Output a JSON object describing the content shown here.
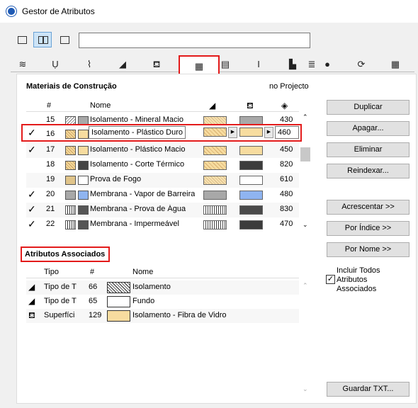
{
  "window": {
    "title": "Gestor de Atributos"
  },
  "colors": {
    "highlight_border": "#e31b1b",
    "active_view": "#cde4f7",
    "beige": "#f7dc9f",
    "blue": "#8fb4f0",
    "dark": "#444444"
  },
  "view_buttons": [
    {
      "icon": "list-view-icon"
    },
    {
      "icon": "dual-list-view-icon"
    },
    {
      "icon": "single-view-icon"
    }
  ],
  "search": {
    "value": "",
    "placeholder": ""
  },
  "tabs": [
    {
      "icon": "layers-icon",
      "glyph": "≋"
    },
    {
      "icon": "pen-icon",
      "glyph": "Ụ"
    },
    {
      "icon": "line-type-icon",
      "glyph": "⌇"
    },
    {
      "icon": "fill-icon",
      "glyph": "◢"
    },
    {
      "icon": "surface-icon",
      "glyph": "⛾"
    },
    {
      "icon": "building-material-icon",
      "glyph": "▦"
    },
    {
      "icon": "composite-icon",
      "glyph": "▤"
    },
    {
      "icon": "profile-icon",
      "glyph": "I"
    },
    {
      "icon": "zone-category-icon",
      "glyph": "▙"
    },
    {
      "icon": "mep-icon",
      "glyph": "≣"
    },
    {
      "icon": "globe-icon",
      "glyph": "●"
    },
    {
      "icon": "operation-profile-icon",
      "glyph": "⟳"
    },
    {
      "icon": "grid-icon",
      "glyph": "▦"
    }
  ],
  "materials": {
    "title": "Materiais de Construção",
    "scope": "no Projecto",
    "columns": {
      "num": "#",
      "name": "Nome"
    },
    "rows": [
      {
        "check": "",
        "num": "15",
        "name": "Isolamento - Mineral Macio",
        "value": "430"
      },
      {
        "check": "✓",
        "num": "16",
        "name": "Isolamento - Plástico Duro",
        "value": "460"
      },
      {
        "check": "✓",
        "num": "17",
        "name": "Isolamento - Plástico Macio",
        "value": "450"
      },
      {
        "check": "",
        "num": "18",
        "name": "Isolamento - Corte Térmico",
        "value": "820"
      },
      {
        "check": "",
        "num": "19",
        "name": "Prova de Fogo",
        "value": "610"
      },
      {
        "check": "✓",
        "num": "20",
        "name": "Membrana - Vapor de Barreira",
        "value": "480"
      },
      {
        "check": "✓",
        "num": "21",
        "name": "Membrana - Prova de Água",
        "value": "830"
      },
      {
        "check": "✓",
        "num": "22",
        "name": "Membrana - Impermeável",
        "value": "470"
      }
    ]
  },
  "buttons": {
    "duplicar": "Duplicar",
    "apagar": "Apagar...",
    "eliminar": "Eliminar",
    "reindexar": "Reindexar...",
    "acrescentar": "Acrescentar >>",
    "por_indice": "Por Índice >>",
    "por_nome": "Por Nome >>",
    "guardar": "Guardar TXT..."
  },
  "associated": {
    "title": "Atributos Associados",
    "columns": {
      "tipo": "Tipo",
      "num": "#",
      "name": "Nome"
    },
    "rows": [
      {
        "tipo": "Tipo de T",
        "num": "66",
        "name": "Isolamento"
      },
      {
        "tipo": "Tipo de T",
        "num": "65",
        "name": "Fundo"
      },
      {
        "tipo": "Superfíci",
        "num": "129",
        "name": "Isolamento - Fibra de Vidro"
      }
    ],
    "include_all_label": "Incluir Todos Atributos Associados",
    "include_all_checked": true
  }
}
